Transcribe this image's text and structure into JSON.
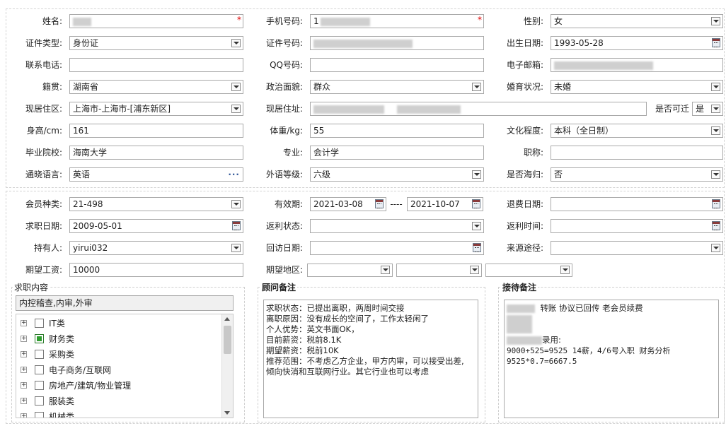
{
  "basic": {
    "name": {
      "label": "姓名:",
      "value": "",
      "required": "*"
    },
    "mobile": {
      "label": "手机号码:",
      "value": "1",
      "required": "*"
    },
    "gender": {
      "label": "性别:",
      "value": "女"
    },
    "id_type": {
      "label": "证件类型:",
      "value": "身份证"
    },
    "id_number": {
      "label": "证件号码:",
      "value": ""
    },
    "birth_date": {
      "label": "出生日期:",
      "value": "1993-05-28"
    },
    "phone": {
      "label": "联系电话:",
      "value": ""
    },
    "qq": {
      "label": "QQ号码:",
      "value": ""
    },
    "email": {
      "label": "电子邮箱:",
      "value": ""
    },
    "native_place": {
      "label": "籍贯:",
      "value": "湖南省"
    },
    "political": {
      "label": "政治面貌:",
      "value": "群众"
    },
    "marital": {
      "label": "婚育状况:",
      "value": "未婚"
    },
    "current_area": {
      "label": "现居住区:",
      "value": "上海市-上海市-[浦东新区]"
    },
    "current_address": {
      "label": "现居住址:",
      "value": ""
    },
    "can_travel": {
      "label": "是否可迁",
      "value": "是"
    },
    "height": {
      "label": "身高/cm:",
      "value": "161"
    },
    "weight": {
      "label": "体重/kg:",
      "value": "55"
    },
    "education": {
      "label": "文化程度:",
      "value": "本科（全日制）"
    },
    "school": {
      "label": "毕业院校:",
      "value": "海南大学"
    },
    "major": {
      "label": "专业:",
      "value": "会计学"
    },
    "title": {
      "label": "职称:",
      "value": ""
    },
    "language": {
      "label": "通晓语言:",
      "value": "英语"
    },
    "language_level": {
      "label": "外语等级:",
      "value": "六级"
    },
    "returnee": {
      "label": "是否海归:",
      "value": "否"
    }
  },
  "membership": {
    "member_type": {
      "label": "会员种类:",
      "value": "21-498"
    },
    "valid_period": {
      "label": "有效期:",
      "from": "2021-03-08",
      "sep": "----",
      "to": "2021-10-07"
    },
    "refund_date": {
      "label": "退费日期:",
      "value": ""
    },
    "job_date": {
      "label": "求职日期:",
      "value": "2009-05-01"
    },
    "rebate_status": {
      "label": "返利状态:",
      "value": ""
    },
    "rebate_time": {
      "label": "返利时间:",
      "value": ""
    },
    "holder": {
      "label": "持有人:",
      "value": "yirui032"
    },
    "visit_date": {
      "label": "回访日期:",
      "value": ""
    },
    "source": {
      "label": "来源途径:",
      "value": ""
    },
    "salary": {
      "label": "期望工资:",
      "value": "10000"
    },
    "region": {
      "label": "期望地区:",
      "v1": "",
      "v2": "",
      "v3": ""
    }
  },
  "job_content": {
    "title": "求职内容",
    "summary": "内控稽查,内审,外审",
    "tree": [
      {
        "label": "IT类",
        "checked": false
      },
      {
        "label": "财务类",
        "checked": true
      },
      {
        "label": "采购类",
        "checked": false
      },
      {
        "label": "电子商务/互联网",
        "checked": false
      },
      {
        "label": "房地产/建筑/物业管理",
        "checked": false
      },
      {
        "label": "服装类",
        "checked": false
      },
      {
        "label": "机械类",
        "checked": false
      }
    ],
    "expand_icon": "+"
  },
  "advisor_notes": {
    "title": "顾问备注",
    "text": "求职状态：已提出离职，两周时间交接\n离职原因：没有成长的空间了，工作太轻闲了\n个人优势：英文书面OK，\n目前薪资：税前8.1K\n期望薪资：税前10K\n推荐范围：不考虑乙方企业，甲方内审，可以接受出差,\n倾向快消和互联网行业。其它行业也可以考虑"
  },
  "reception_notes": {
    "title": "接待备注",
    "line1": "转账 协议已回传  老会员续费",
    "line2": "录用:",
    "line3": "9000+525=9525  14薪，4/6号入职  财务分析",
    "line4": "9525*0.7=6667.5"
  },
  "colors": {
    "required": "#dd0000",
    "checked": "#2e9e2e",
    "border": "#a9a9a9"
  }
}
